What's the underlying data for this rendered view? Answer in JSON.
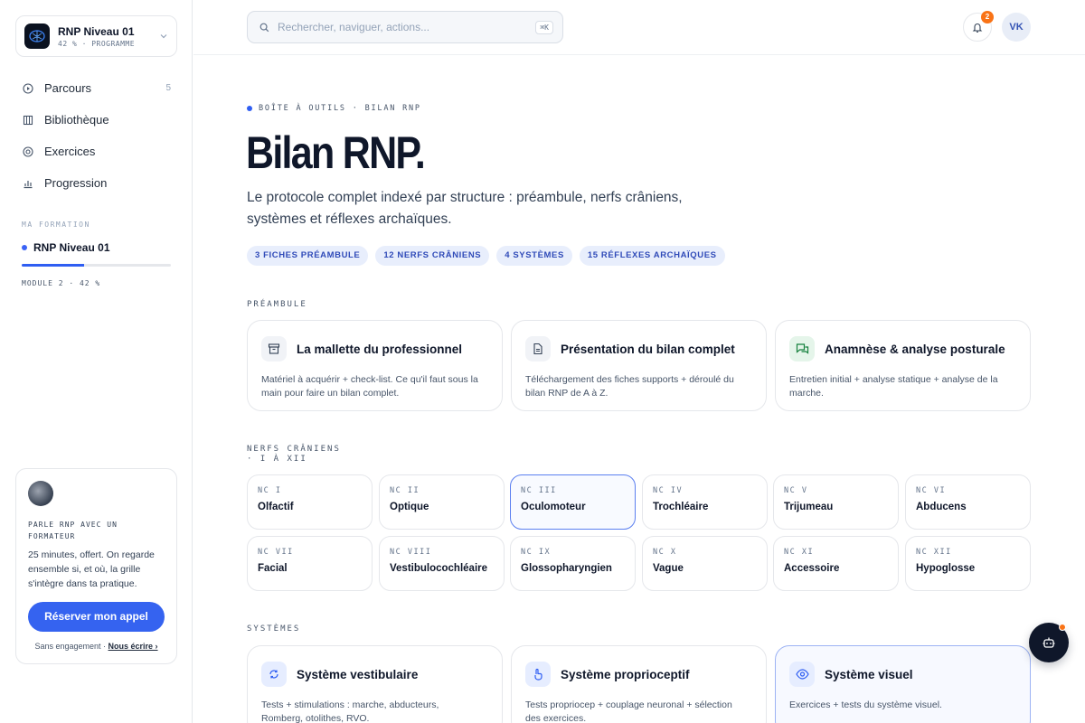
{
  "org": {
    "name": "RNP Niveau 01",
    "sub": "42 % · PROGRAMME"
  },
  "nav": [
    {
      "label": "Parcours",
      "count": "5",
      "icon": "play-circle-icon"
    },
    {
      "label": "Bibliothèque",
      "count": "",
      "icon": "library-icon"
    },
    {
      "label": "Exercices",
      "count": "",
      "icon": "target-icon"
    },
    {
      "label": "Progression",
      "count": "",
      "icon": "bar-chart-icon"
    }
  ],
  "formation": {
    "section_label": "MA FORMATION",
    "name": "RNP Niveau 01",
    "progress": 0.42,
    "module_label": "MODULE 2 · 42 %"
  },
  "call": {
    "title": "PARLE RNP AVEC UN FORMATEUR",
    "desc": "25 minutes, offert. On regarde ensemble si, et où, la grille s'intègre dans ta pratique.",
    "button": "Réserver mon appel",
    "foot_text": "Sans engagement ·",
    "foot_link": "Nous écrire ›"
  },
  "topbar": {
    "search_placeholder": "Rechercher, naviguer, actions...",
    "shortcut": "⌘K",
    "notif_count": "2",
    "user_initials": "VK"
  },
  "header": {
    "eyebrow": "BOÎTE À OUTILS · BILAN RNP",
    "title": "Bilan RNP.",
    "desc": "Le protocole complet indexé par structure : préambule, nerfs crâniens, systèmes et réflexes archaïques.",
    "pills": [
      "3 FICHES PRÉAMBULE",
      "12 NERFS CRÂNIENS",
      "4 SYSTÈMES",
      "15 RÉFLEXES ARCHAÏQUES"
    ]
  },
  "preambule": {
    "label": "PRÉAMBULE",
    "cards": [
      {
        "title": "La mallette du professionnel",
        "desc": "Matériel à acquérir + check-list. Ce qu'il faut sous la main pour faire un bilan complet.",
        "icon": "briefcase-icon"
      },
      {
        "title": "Présentation du bilan complet",
        "desc": "Téléchargement des fiches supports + déroulé du bilan RNP de A à Z.",
        "icon": "document-icon"
      },
      {
        "title": "Anamnèse & analyse posturale",
        "desc": "Entretien initial + analyse statique + analyse de la marche.",
        "icon": "chat-icon"
      }
    ]
  },
  "nerfs": {
    "label_line1": "NERFS CRÂNIENS",
    "label_line2": "· I À XII",
    "items": [
      {
        "code": "NC I",
        "name": "Olfactif"
      },
      {
        "code": "NC II",
        "name": "Optique"
      },
      {
        "code": "NC III",
        "name": "Oculomoteur"
      },
      {
        "code": "NC IV",
        "name": "Trochléaire"
      },
      {
        "code": "NC V",
        "name": "Trijumeau"
      },
      {
        "code": "NC VI",
        "name": "Abducens"
      },
      {
        "code": "NC VII",
        "name": "Facial"
      },
      {
        "code": "NC VIII",
        "name": "Vestibulocochléaire"
      },
      {
        "code": "NC IX",
        "name": "Glossopharyngien"
      },
      {
        "code": "NC X",
        "name": "Vague"
      },
      {
        "code": "NC XI",
        "name": "Accessoire"
      },
      {
        "code": "NC XII",
        "name": "Hypoglosse"
      }
    ]
  },
  "systemes": {
    "label": "SYSTÈMES",
    "cards": [
      {
        "title": "Système vestibulaire",
        "desc": "Tests + stimulations : marche, abducteurs, Romberg, otolithes, RVO.",
        "icon": "balance-icon"
      },
      {
        "title": "Système proprioceptif",
        "desc": "Tests propriocep + couplage neuronal + sélection des exercices.",
        "icon": "hand-icon"
      },
      {
        "title": "Système visuel",
        "desc": "Exercices + tests du système visuel.",
        "icon": "eye-icon"
      }
    ]
  },
  "colors": {
    "accent": "#2f5ef2",
    "badge": "#f97316"
  }
}
